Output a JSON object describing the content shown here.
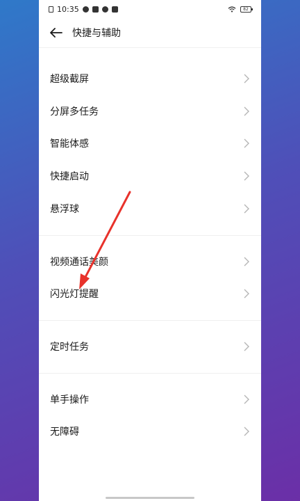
{
  "status_bar": {
    "time": "10:35",
    "battery": "82"
  },
  "header": {
    "title": "快捷与辅助"
  },
  "items": [
    {
      "label": "超级截屏"
    },
    {
      "label": "分屏多任务"
    },
    {
      "label": "智能体感"
    },
    {
      "label": "快捷启动"
    },
    {
      "label": "悬浮球"
    },
    {
      "label": "视频通话美颜"
    },
    {
      "label": "闪光灯提醒"
    },
    {
      "label": "定时任务"
    },
    {
      "label": "单手操作"
    },
    {
      "label": "无障碍"
    }
  ],
  "colors": {
    "text": "#1a1a1a",
    "chevron": "#b5b5b5",
    "annotation_arrow": "#e8322b"
  }
}
